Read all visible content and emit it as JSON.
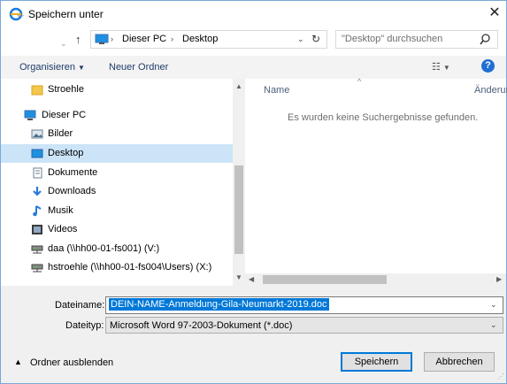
{
  "window": {
    "title": "Speichern unter"
  },
  "nav": {
    "breadcrumb": [
      "Dieser PC",
      "Desktop"
    ],
    "search_placeholder": "\"Desktop\" durchsuchen"
  },
  "toolbar": {
    "organize_label": "Organisieren",
    "new_folder_label": "Neuer Ordner"
  },
  "sidebar": {
    "items": [
      {
        "label": "Stroehle",
        "icon": "folder-icon"
      },
      {
        "label": "Dieser PC",
        "icon": "computer-icon"
      },
      {
        "label": "Bilder",
        "icon": "pictures-icon"
      },
      {
        "label": "Desktop",
        "icon": "desktop-icon",
        "selected": true
      },
      {
        "label": "Dokumente",
        "icon": "documents-icon"
      },
      {
        "label": "Downloads",
        "icon": "downloads-icon"
      },
      {
        "label": "Musik",
        "icon": "music-icon"
      },
      {
        "label": "Videos",
        "icon": "videos-icon"
      },
      {
        "label": "daa (\\\\hh00-01-fs001) (V:)",
        "icon": "network-drive-icon"
      },
      {
        "label": "hstroehle (\\\\hh00-01-fs004\\Users) (X:)",
        "icon": "network-drive-icon"
      }
    ]
  },
  "filelist": {
    "columns": [
      "Name",
      "Änderun"
    ],
    "empty_message": "Es wurden keine Suchergebnisse gefunden."
  },
  "form": {
    "filename_label": "Dateiname:",
    "filename_value": "DEIN-NAME-Anmeldung-Gila-Neumarkt-2019.doc",
    "filetype_label": "Dateityp:",
    "filetype_value": "Microsoft Word 97-2003-Dokument (*.doc)"
  },
  "footer": {
    "hide_folders_label": "Ordner ausblenden",
    "save_label": "Speichern",
    "cancel_label": "Abbrechen"
  },
  "colors": {
    "accent": "#0078d7",
    "selection": "#cce4f7"
  }
}
